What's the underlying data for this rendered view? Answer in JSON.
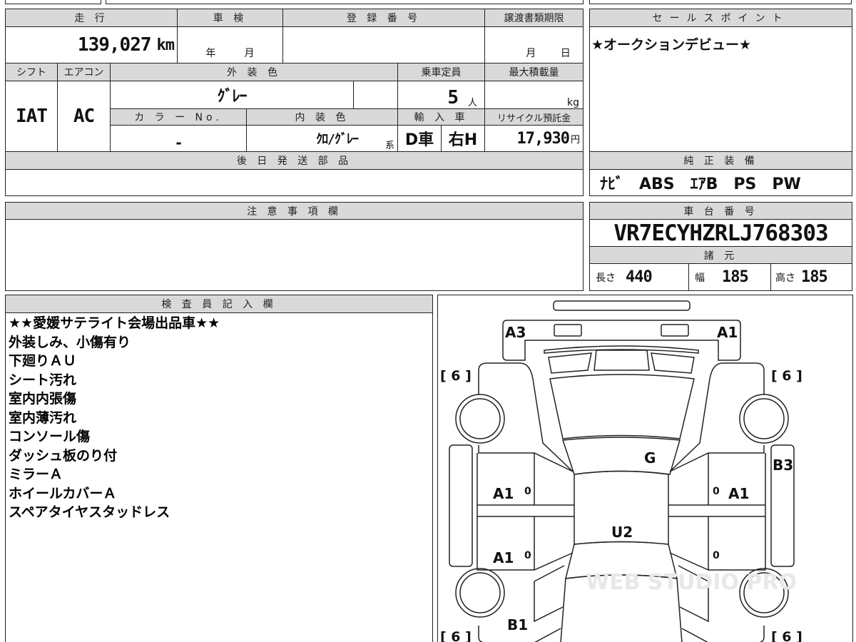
{
  "mileage": {
    "label": "走 行",
    "value": "139,027",
    "unit": "km"
  },
  "shaken": {
    "label": "車 検",
    "year_unit": "年",
    "month_unit": "月"
  },
  "registration": {
    "label": "登 録 番 号"
  },
  "transfer_deadline": {
    "label": "譲渡書類期限",
    "month_unit": "月",
    "day_unit": "日"
  },
  "shift": {
    "label": "シフト",
    "value": "IAT"
  },
  "aircon": {
    "label": "エアコン",
    "value": "AC"
  },
  "exterior_color": {
    "label": "外 装 色",
    "value": "ｸﾞﾚｰ"
  },
  "capacity": {
    "label": "乗車定員",
    "value": "5",
    "unit": "人"
  },
  "max_load": {
    "label": "最大積載量",
    "unit": "kg"
  },
  "color_no": {
    "label": "カ ラ ー No.",
    "value": "-"
  },
  "interior_color": {
    "label": "内 装 色",
    "value": "ｸﾛ/ｸﾞﾚｰ",
    "suffix": "系"
  },
  "import": {
    "label": "輸 入 車",
    "type": "D車",
    "steering": "右H"
  },
  "recycle": {
    "label": "リサイクル預託金",
    "value": "17,930",
    "unit": "円"
  },
  "later_parts": {
    "label": "後 日 発 送 部 品"
  },
  "notes": {
    "label": "注 意 事 項 欄"
  },
  "sales_point": {
    "label": "セールスポイント",
    "text": "★オークションデビュー★"
  },
  "equipment": {
    "label": "純 正 装 備",
    "items": "ﾅﾋﾞ　ABS　ｴｱB　PS　PW"
  },
  "chassis": {
    "label": "車 台 番 号",
    "value": "VR7ECYHZRLJ768303"
  },
  "specs": {
    "label": "諸 元",
    "length_label": "長さ",
    "length": "440",
    "width_label": "幅",
    "width": "185",
    "height_label": "高さ",
    "height": "185"
  },
  "inspector": {
    "label": "検 査 員 記 入 欄",
    "lines": [
      "★★愛媛サテライト会場出品車★★",
      "外装しみ、小傷有り",
      "下廻りＡＵ",
      "シート汚れ",
      "室内内張傷",
      "室内薄汚れ",
      "コンソール傷",
      "ダッシュ板のり付",
      "ミラーＡ",
      "ホイールカバーＡ",
      "スペアタイヤスタッドレス"
    ]
  },
  "diagram": {
    "front_left": "A3",
    "front_right": "A1",
    "tire_fl": "[ 6 ]",
    "tire_fr": "[ 6 ]",
    "tire_rl": "[ 6 ]",
    "tire_rr": "[ 6 ]",
    "windshield": "G",
    "right_sill": "B3",
    "left_front_door": "A1",
    "right_front_door": "A1",
    "roof": "U2",
    "left_rear_door": "A1",
    "rear_left": "B1",
    "mark_lf": "0",
    "mark_lr": "0",
    "mark_rf": "0",
    "mark_rr": "0",
    "watermark": "WEB STUDIO PRO"
  }
}
